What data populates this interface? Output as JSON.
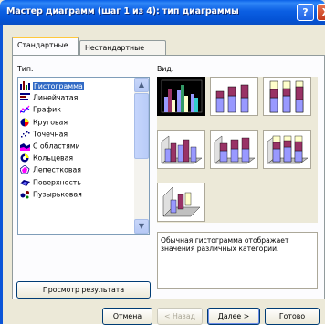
{
  "window": {
    "title": "Мастер диаграмм (шаг 1 из 4): тип диаграммы",
    "help_symbol": "?",
    "close_symbol": "X"
  },
  "tabs": [
    {
      "label": "Стандартные",
      "active": true
    },
    {
      "label": "Нестандартные",
      "active": false
    }
  ],
  "type_label": "Тип:",
  "view_label": "Вид:",
  "chart_types": [
    {
      "label": "Гистограмма",
      "icon": "column-chart-icon",
      "selected": true
    },
    {
      "label": "Линейчатая",
      "icon": "bar-chart-icon",
      "selected": false
    },
    {
      "label": "График",
      "icon": "line-chart-icon",
      "selected": false
    },
    {
      "label": "Круговая",
      "icon": "pie-chart-icon",
      "selected": false
    },
    {
      "label": "Точечная",
      "icon": "scatter-chart-icon",
      "selected": false
    },
    {
      "label": "С областями",
      "icon": "area-chart-icon",
      "selected": false
    },
    {
      "label": "Кольцевая",
      "icon": "doughnut-chart-icon",
      "selected": false
    },
    {
      "label": "Лепестковая",
      "icon": "radar-chart-icon",
      "selected": false
    },
    {
      "label": "Поверхность",
      "icon": "surface-chart-icon",
      "selected": false
    },
    {
      "label": "Пузырьковая",
      "icon": "bubble-chart-icon",
      "selected": false
    }
  ],
  "subtypes": [
    {
      "name": "clustered-column",
      "selected": true
    },
    {
      "name": "stacked-column",
      "selected": false
    },
    {
      "name": "100-stacked-column",
      "selected": false
    },
    {
      "name": "3d-clustered-column",
      "selected": false
    },
    {
      "name": "3d-stacked-column",
      "selected": false
    },
    {
      "name": "3d-100-stacked-column",
      "selected": false
    },
    {
      "name": "3d-column",
      "selected": false
    }
  ],
  "description": "Обычная гистограмма отображает значения различных категорий.",
  "preview_button": "Просмотр результата",
  "buttons": {
    "cancel": "Отмена",
    "back": "< Назад",
    "next": "Далее >",
    "finish": "Готово"
  },
  "colors": {
    "title_bar": "#0b5fe3",
    "selection": "#316ac5",
    "series1": "#9999ff",
    "series2": "#993366",
    "series3": "#ffffcc"
  }
}
